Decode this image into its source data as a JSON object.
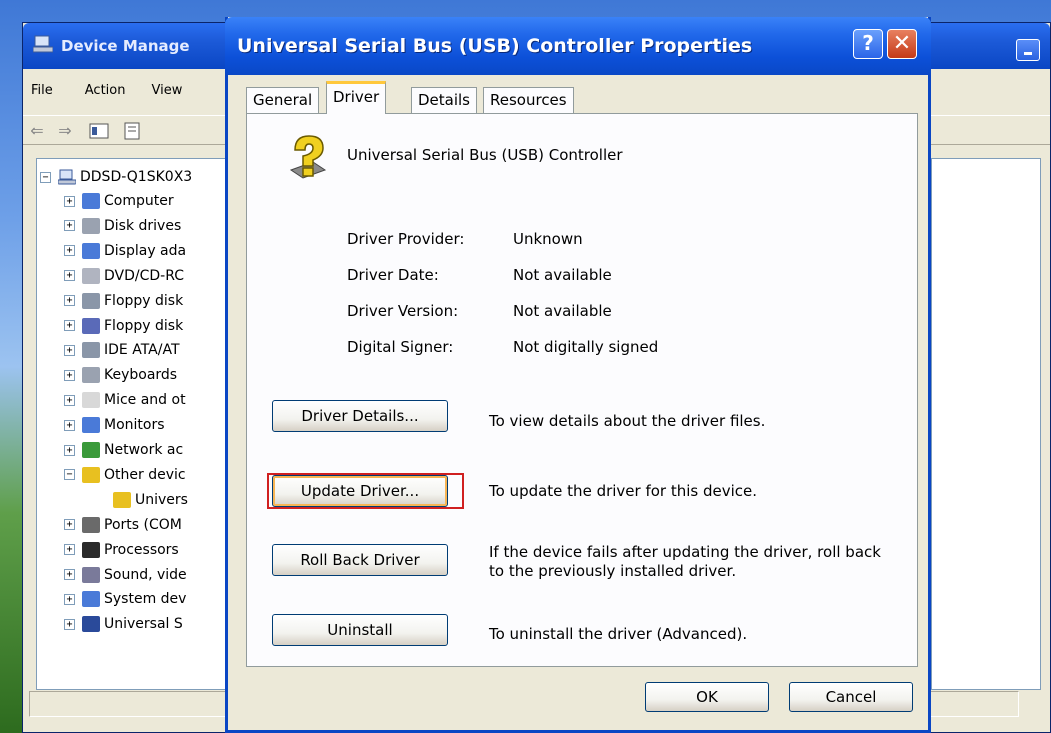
{
  "device_manager": {
    "title": "Device Manage",
    "menu": [
      "File",
      "Action",
      "View"
    ],
    "root_node": "DDSD-Q1SK0X3",
    "tree_items": [
      {
        "label": "Computer",
        "expander": "+",
        "color": "#4a7ad8"
      },
      {
        "label": "Disk drives",
        "expander": "+",
        "color": "#9aa2b0"
      },
      {
        "label": "Display ada",
        "expander": "+",
        "color": "#4a7ad8"
      },
      {
        "label": "DVD/CD-RC",
        "expander": "+",
        "color": "#b0b4c0"
      },
      {
        "label": "Floppy disk",
        "expander": "+",
        "color": "#8a96a8"
      },
      {
        "label": "Floppy disk",
        "expander": "+",
        "color": "#5a6ab8"
      },
      {
        "label": "IDE ATA/AT",
        "expander": "+",
        "color": "#8a96a8"
      },
      {
        "label": "Keyboards",
        "expander": "+",
        "color": "#9aa2b0"
      },
      {
        "label": "Mice and ot",
        "expander": "+",
        "color": "#d8d8d8"
      },
      {
        "label": "Monitors",
        "expander": "+",
        "color": "#4a7ad8"
      },
      {
        "label": "Network ac",
        "expander": "+",
        "color": "#3a9a3a"
      },
      {
        "label": "Other devic",
        "expander": "−",
        "color": "#e8c020"
      },
      {
        "label": "Univers",
        "expander": "",
        "color": "#e8c020",
        "child": true
      },
      {
        "label": "Ports (COM",
        "expander": "+",
        "color": "#6a6a6a"
      },
      {
        "label": "Processors",
        "expander": "+",
        "color": "#2a2a2a"
      },
      {
        "label": "Sound, vide",
        "expander": "+",
        "color": "#7a7a9a"
      },
      {
        "label": "System dev",
        "expander": "+",
        "color": "#4a7ad8"
      },
      {
        "label": "Universal S",
        "expander": "+",
        "color": "#2a4a9a"
      }
    ]
  },
  "dialog": {
    "title": "Universal Serial Bus (USB) Controller Properties",
    "help_label": "?",
    "close_label": "✕",
    "tabs": [
      "General",
      "Driver",
      "Details",
      "Resources"
    ],
    "active_tab": "Driver",
    "device_name": "Universal Serial Bus (USB) Controller",
    "info": [
      {
        "label": "Driver Provider:",
        "value": "Unknown"
      },
      {
        "label": "Driver Date:",
        "value": "Not available"
      },
      {
        "label": "Driver Version:",
        "value": "Not available"
      },
      {
        "label": "Digital Signer:",
        "value": "Not digitally signed"
      }
    ],
    "actions": [
      {
        "button": "Driver Details...",
        "description": "To view details about the driver files."
      },
      {
        "button": "Update Driver...",
        "description": "To update the driver for this device."
      },
      {
        "button": "Roll Back Driver",
        "description": "If the device fails after updating the driver, roll back to the previously installed driver."
      },
      {
        "button": "Uninstall",
        "description": "To uninstall the driver (Advanced)."
      }
    ],
    "ok_label": "OK",
    "cancel_label": "Cancel"
  },
  "colors": {
    "title_bar": "#0c50d8",
    "highlight": "#d02020",
    "dialog_bg": "#ece9d8"
  }
}
